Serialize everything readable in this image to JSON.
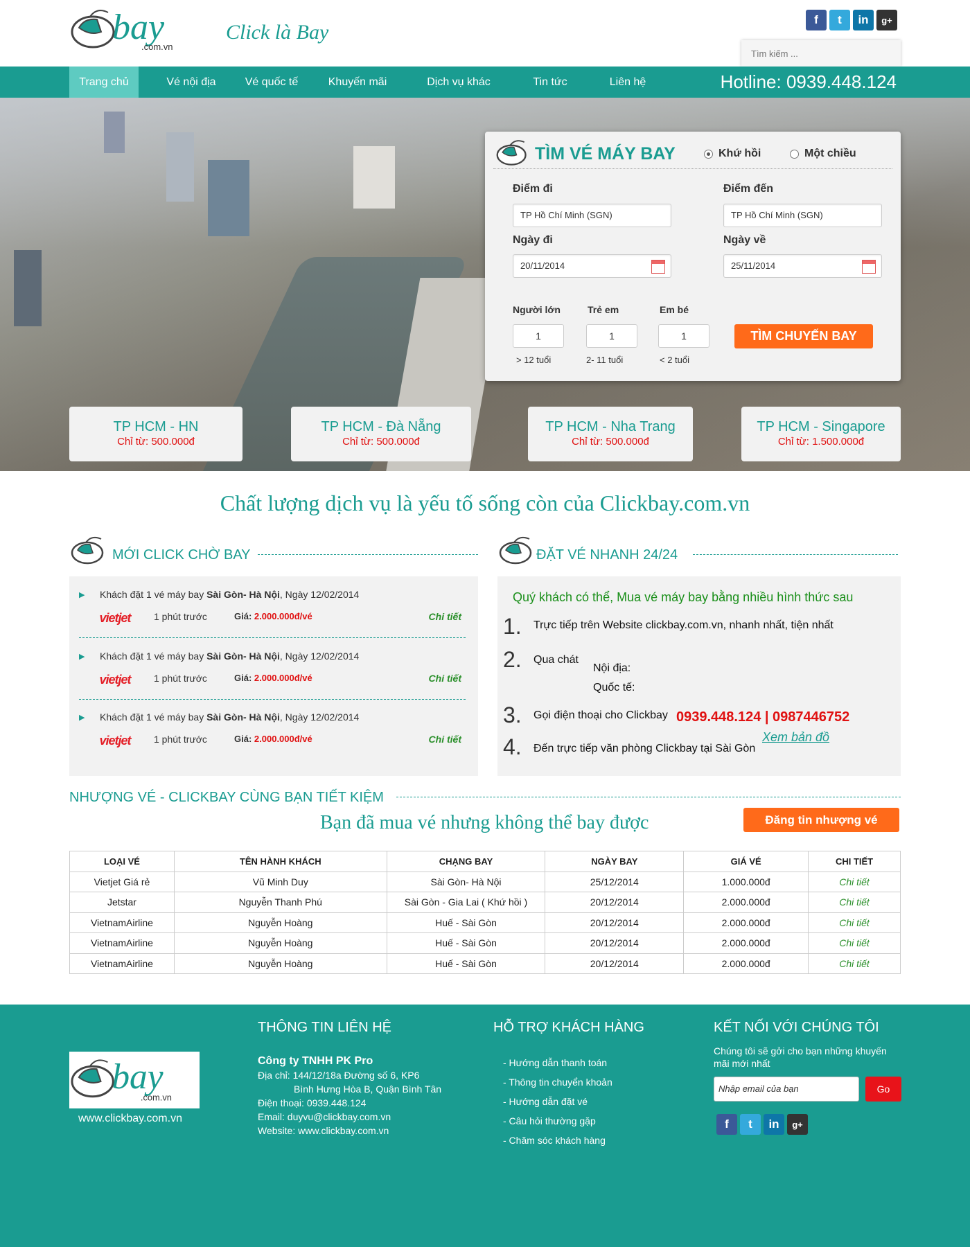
{
  "header": {
    "logo_text": "bay",
    "logo_sub": ".com.vn",
    "tagline": "Click là Bay",
    "search_placeholder": "Tìm kiếm ...",
    "social": [
      "facebook-icon",
      "twitter-icon",
      "linkedin-icon",
      "google-plus-icon"
    ]
  },
  "nav": {
    "items": [
      "Trang chủ",
      "Vé nội địa",
      "Vé quốc tế",
      "Khuyến mãi",
      "Dịch vụ khác",
      "Tin tức",
      "Liên hệ"
    ],
    "active_index": 0,
    "hotline": "Hotline: 0939.448.124"
  },
  "search_panel": {
    "title": "TÌM VÉ MÁY BAY",
    "trip_round": "Khứ hồi",
    "trip_oneway": "Một chiều",
    "trip_selected": "round",
    "from_label": "Điểm đi",
    "from_value": "TP Hồ Chí Minh (SGN)",
    "to_label": "Điểm đến",
    "to_value": "TP Hồ Chí Minh (SGN)",
    "depart_label": "Ngày đi",
    "depart_value": "20/11/2014",
    "return_label": "Ngày về",
    "return_value": "25/11/2014",
    "adult_label": "Người lớn",
    "adult_value": "1",
    "adult_note": "> 12 tuổi",
    "child_label": "Trẻ em",
    "child_value": "1",
    "child_note": "2- 11 tuổi",
    "infant_label": "Em bé",
    "infant_value": "1",
    "infant_note": "< 2 tuổi",
    "search_button": "TÌM CHUYẾN BAY"
  },
  "routes": [
    {
      "name": "TP HCM - HN",
      "price": "Chỉ từ: 500.000đ"
    },
    {
      "name": "TP HCM - Đà Nẵng",
      "price": "Chỉ từ: 500.000đ"
    },
    {
      "name": "TP HCM - Nha Trang",
      "price": "Chỉ từ: 500.000đ"
    },
    {
      "name": "TP HCM - Singapore",
      "price": "Chỉ từ: 1.500.000đ"
    }
  ],
  "slogan": "Chất lượng dịch vụ là yếu tố sống còn của Clickbay.com.vn",
  "recent": {
    "title": "MỚI CLICK CHỜ BAY",
    "items": [
      {
        "prefix": "Khách đặt 1 vé máy bay ",
        "route": "Sài Gòn- Hà Nội",
        "date": ", Ngày 12/02/2014",
        "airline": "vietjet",
        "time": "1 phút trước",
        "price_label": "Giá: ",
        "price": "2.000.000đ/vé",
        "detail": "Chi tiết"
      },
      {
        "prefix": "Khách đặt 1 vé máy bay ",
        "route": "Sài Gòn- Hà Nội",
        "date": ", Ngày 12/02/2014",
        "airline": "vietjet",
        "time": "1 phút trước",
        "price_label": "Giá: ",
        "price": "2.000.000đ/vé",
        "detail": "Chi tiết"
      },
      {
        "prefix": "Khách đặt 1 vé máy bay ",
        "route": "Sài Gòn- Hà Nội",
        "date": ", Ngày 12/02/2014",
        "airline": "vietjet",
        "time": "1 phút trước",
        "price_label": "Giá: ",
        "price": "2.000.000đ/vé",
        "detail": "Chi tiết"
      }
    ]
  },
  "quick": {
    "title": "ĐẶT VÉ NHANH 24/24",
    "intro": "Quý khách có thể, Mua vé máy bay bằng nhiều hình thức sau",
    "n1": "1.",
    "t1": "Trực tiếp trên Website clickbay.com.vn, nhanh nhất, tiện nhất",
    "n2": "2.",
    "t2": "Qua chát",
    "chat_domestic": "Nội địa:",
    "chat_intl": "Quốc tế:",
    "n3": "3.",
    "t3": "Gọi điện thoại cho Clickbay",
    "phone": "0939.448.124 | 0987446752",
    "n4": "4.",
    "t4": "Đến trực tiếp văn phòng Clickbay tại Sài Gòn",
    "map_link": "Xem bản đồ"
  },
  "resale": {
    "title": "NHƯỢNG VÉ - CLICKBAY CÙNG BẠN TIẾT KIỆM",
    "subtitle": "Bạn đã mua vé nhưng không thể bay được",
    "post_button": "Đăng tin nhượng vé",
    "columns": [
      "LOẠI VÉ",
      "TÊN HÀNH KHÁCH",
      "CHẠNG BAY",
      "NGÀY BAY",
      "GIÁ VÉ",
      "CHI TIẾT"
    ],
    "rows": [
      [
        "Vietjet Giá rẻ",
        "Vũ Minh Duy",
        "Sài Gòn- Hà Nội",
        "25/12/2014",
        "1.000.000đ",
        "Chi tiết"
      ],
      [
        "Jetstar",
        "Nguyễn Thanh Phú",
        "Sài Gòn - Gia Lai ( Khứ hồi )",
        "20/12/2014",
        "2.000.000đ",
        "Chi tiết"
      ],
      [
        "VietnamAirline",
        "Nguyễn Hoàng",
        "Huế - Sài Gòn",
        "20/12/2014",
        "2.000.000đ",
        "Chi tiết"
      ],
      [
        "VietnamAirline",
        "Nguyễn Hoàng",
        "Huế - Sài Gòn",
        "20/12/2014",
        "2.000.000đ",
        "Chi tiết"
      ],
      [
        "VietnamAirline",
        "Nguyễn Hoàng",
        "Huế - Sài Gòn",
        "20/12/2014",
        "2.000.000đ",
        "Chi tiết"
      ]
    ]
  },
  "footer": {
    "url": "www.clickbay.com.vn",
    "contact_title": "THÔNG TIN LIÊN HỆ",
    "company": "Công ty TNHH PK Pro",
    "address1": "Địa chỉ: 144/12/18a Đường số 6, KP6",
    "address2": "Bình Hưng Hòa B, Quận Bình Tân",
    "phone": "Điện thoại: 0939.448.124",
    "email": "Email: duyvu@clickbay.com.vn",
    "website": "Website: www.clickbay.com.vn",
    "support_title": "HỖ TRỢ KHÁCH HÀNG",
    "support_links": [
      "- Hướng dẫn thanh toán",
      "- Thông tin chuyển khoản",
      "- Hướng dẫn đặt vé",
      "- Câu hỏi thường gặp",
      "- Chăm sóc khách hàng"
    ],
    "connect_title": "KẾT NỐI VỚI CHÚNG TÔI",
    "connect_desc": "Chúng tôi sẽ gởi cho bạn những khuyến mãi mới nhất",
    "email_placeholder": "Nhập email của bạn",
    "go_button": "Go"
  },
  "colors": {
    "teal": "#1a9c91",
    "orange": "#ff6a1a",
    "red": "#e01010"
  }
}
